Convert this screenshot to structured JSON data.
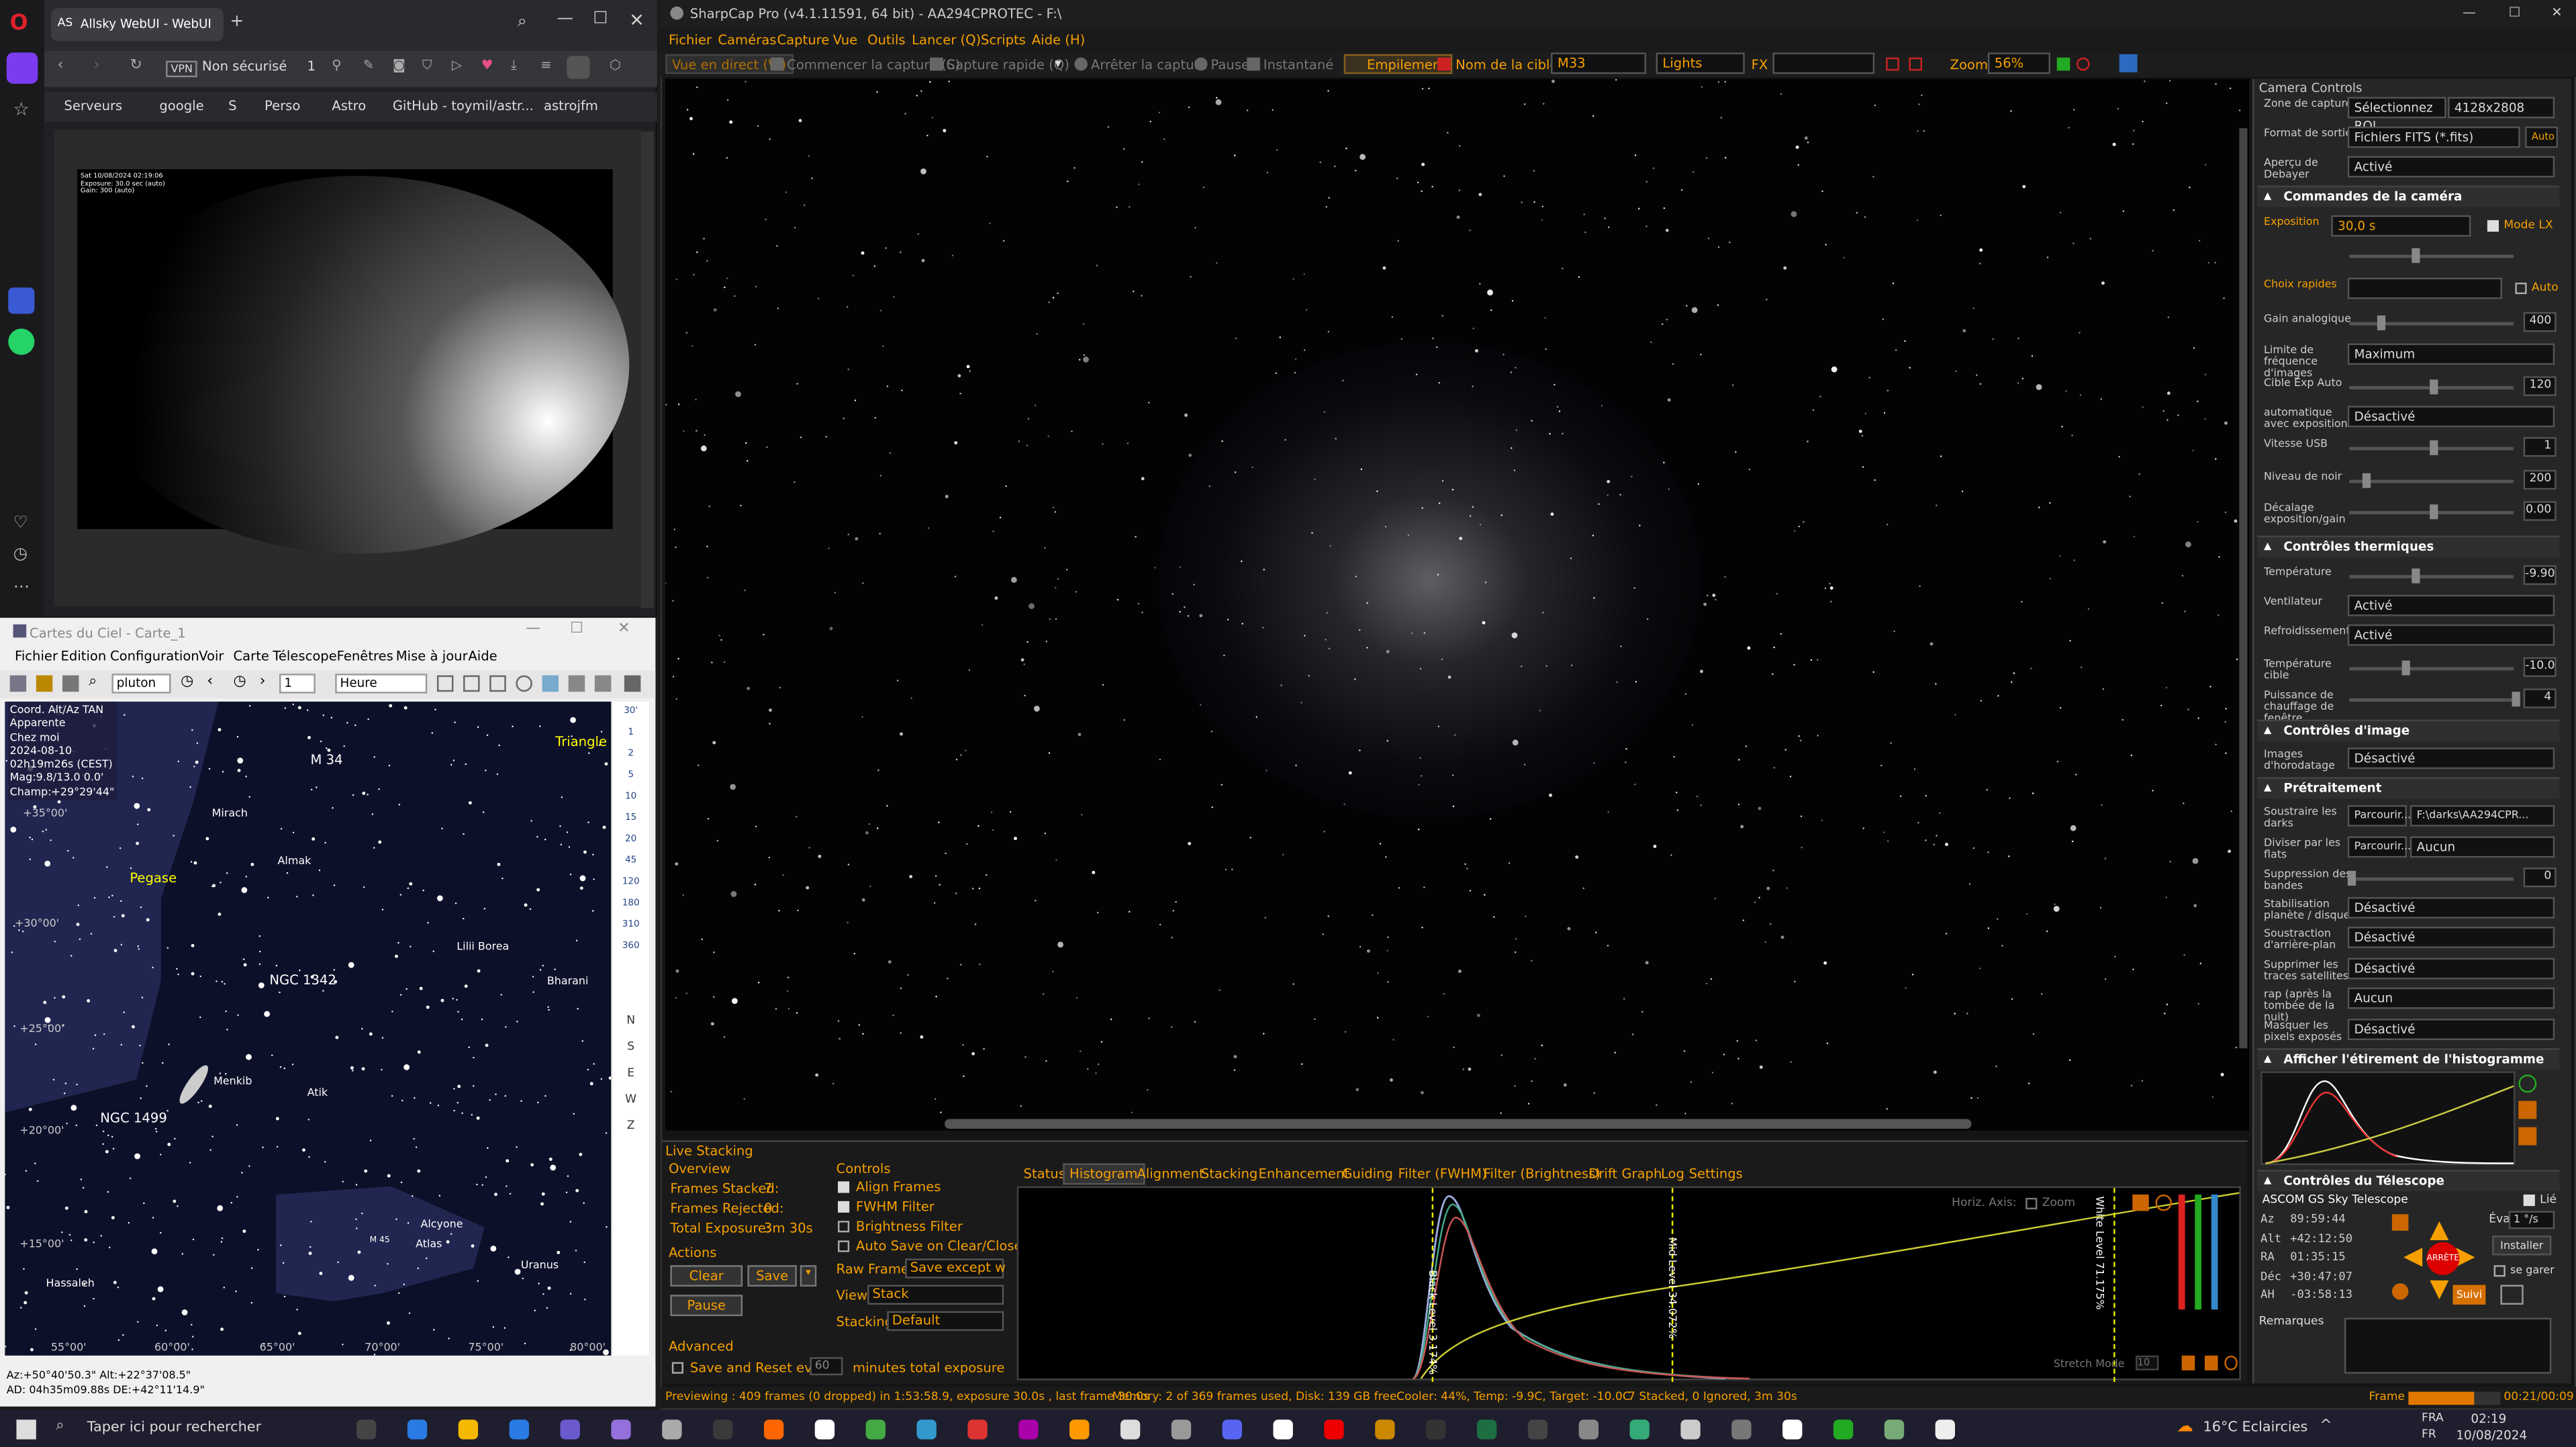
{
  "opera": {
    "tab_title": "Allsky WebUI - WebUI",
    "tab_icon": "AS",
    "security": "Non sécurisé",
    "vpn": "VPN",
    "tab_count": "1",
    "bookmarks": [
      "Serveurs",
      "google",
      "S",
      "Perso",
      "Astro",
      "GitHub - toymil/astr...",
      "astrojfm"
    ],
    "allsky_overlay": [
      "Sat 10/08/2024 02:19:06",
      "Exposure: 30.0 sec (auto)",
      "Gain: 300 (auto)"
    ]
  },
  "cdc": {
    "title": "Cartes du Ciel - Carte_1",
    "menu": [
      "Fichier",
      "Edition",
      "Configuration",
      "Voir",
      "Carte",
      "Télescope",
      "Fenêtres",
      "Mise à jour",
      "Aide"
    ],
    "search_value": "pluton",
    "step_value": "1",
    "time_unit": "Heure",
    "info": [
      "Coord. Alt/Az TAN",
      "Apparente",
      "Chez moi",
      "2024-08-10",
      "02h19m26s (CEST)",
      "Mag:9.8/13.0 0.0'",
      "Champ:+29°29'44\""
    ],
    "labels": {
      "triangle": "Triangle",
      "m34": "M 34",
      "mirach": "Mirach",
      "almak": "Almak",
      "pegase": "Pegase",
      "ngc1342": "NGC 1342",
      "ngc1499": "NGC 1499",
      "lilii": "Lilii Borea",
      "bharani": "Bharani",
      "menkib": "Menkib",
      "atik": "Atik",
      "alcyone": "Alcyone",
      "atlas": "Atlas",
      "uranus": "Uranus",
      "hassaleh": "Hassaleh",
      "m45": "M 45"
    },
    "ticks_y": [
      "+35°00'",
      "+30°00'",
      "+25°00'",
      "+20°00'",
      "+15°00'"
    ],
    "ticks_x": [
      "55°00'",
      "60°00'",
      "65°00'",
      "70°00'",
      "75°00'",
      "80°00'"
    ],
    "right_scale": [
      "30'",
      "1",
      "2",
      "5",
      "10",
      "15",
      "20",
      "45",
      "120",
      "180",
      "310",
      "360"
    ],
    "compass": [
      "N",
      "S",
      "E",
      "W",
      "Z"
    ],
    "status": [
      "Az:+50°40'50.3\" Alt:+22°37'08.5\"",
      "AD: 04h35m09.88s DE:+42°11'14.9\""
    ]
  },
  "sharpcap": {
    "title": "SharpCap Pro (v4.1.11591, 64 bit) - AA294CPROTEC - F:\\",
    "window_controls": [
      "—",
      "☐",
      "✕"
    ],
    "menu": [
      "Fichier",
      "Caméras",
      "Capture",
      "Vue",
      "Outils",
      "Lancer (Q)",
      "Scripts",
      "Aide (H)"
    ],
    "toolbar": {
      "live": "Vue en direct (W)",
      "start": "Commencer la capture (S)",
      "quick": "Capture rapide (Q)",
      "stop": "Arrêter la capture",
      "pause": "Pause",
      "snap": "Instantané",
      "stack": "Empilement",
      "target_label": "Nom de la cible:",
      "target": "M33",
      "frame_type": "Lights",
      "fx": "FX",
      "zoom_label": "Zoom:",
      "zoom": "56%"
    },
    "panel": {
      "title": "Camera Controls",
      "rows1": [
        [
          "Zone de capture",
          "Sélectionnez ROI",
          "4128x2808"
        ],
        [
          "Format de sortie",
          "Fichiers FITS (*.fits)",
          "Auto"
        ],
        [
          "Aperçu de Debayer",
          "Activé",
          ""
        ]
      ],
      "sec_camera": "Commandes de la caméra",
      "exposition_label": "Exposition",
      "exposition": "30,0 s",
      "mode_lx": "Mode LX",
      "quick_label": "Choix rapides",
      "auto_label": "Auto",
      "gain_label": "Gain analogique",
      "gain": "400",
      "fps_label": "Limite de fréquence d'images",
      "fps": "Maximum",
      "target_label": "Cible Exp Auto",
      "target": "120",
      "autoexp_label": "automatique avec exposition",
      "autoexp": "Désactivé",
      "usb_label": "Vitesse USB",
      "usb": "1",
      "black_label": "Niveau de noir",
      "black": "200",
      "offset_label": "Décalage exposition/gain",
      "offset": "0.00",
      "sec_thermal": "Contrôles thermiques",
      "temp_label": "Température",
      "temp": "-9.90",
      "fan_label": "Ventilateur",
      "fan": "Activé",
      "cool_label": "Refroidissement",
      "cool": "Activé",
      "ttarget_label": "Température cible",
      "ttarget": "-10.0",
      "heat_label": "Puissance de chauffage de fenêtre",
      "heat": "4",
      "sec_image": "Contrôles d'image",
      "ts_label": "Images d'horodatage",
      "ts": "Désactivé",
      "sec_pre": "Prétraitement",
      "darks_label": "Soustraire les darks",
      "browse": "Parcourir...",
      "darks": "F:\\darks\\AA294CPR...",
      "flats_label": "Diviser par les flats",
      "flats": "Aucun",
      "band_label": "Suppression des bandes",
      "band": "0",
      "stab_label": "Stabilisation planète / disque",
      "stab": "Désactivé",
      "bg_label": "Soustraction d'arrière-plan",
      "bg": "Désactivé",
      "sat_label": "Supprimer les traces satellites",
      "sat": "Désactivé",
      "rap_label": "rap (après la tombée de la nuit)",
      "rap": "Aucun",
      "hot_label": "Masquer les pixels exposés",
      "hot": "Désactivé",
      "sec_hist": "Afficher l'étirement de l'histogramme",
      "sec_scope": "Contrôles du Télescope",
      "scope_name": "ASCOM GS Sky Telescope",
      "link": "Lié",
      "az_lab": "Az",
      "az": "89:59:44",
      "alt_lab": "Alt",
      "alt": "+42:12:50",
      "ra_lab": "RA",
      "ra": "01:35:15",
      "dec_lab": "Déc",
      "dec": "+30:47:07",
      "ah_lab": "AH",
      "ah": "-03:58:13",
      "slew_label": "Évaluer:",
      "slew": "1 °/s",
      "install": "Installer",
      "park_label": "se garer",
      "track": "Suivi",
      "stop": "ARRÊTE",
      "notes": "Remarques"
    },
    "stacking": {
      "title": "Live Stacking",
      "overview": "Overview",
      "stacked_l": "Frames Stacked:",
      "stacked": "7",
      "rej_l": "Frames Rejected:",
      "rej": "0",
      "tot_l": "Total Exposure:",
      "tot": "3m 30s",
      "actions": "Actions",
      "clear": "Clear",
      "save": "Save",
      "pause": "Pause",
      "advanced": "Advanced",
      "save_reset": "Save and Reset every",
      "save_min": "60",
      "minutes": "minutes total exposure",
      "controls": "Controls",
      "align": "Align Frames",
      "fwhm": "FWHM Filter",
      "bright": "Brightness Filter",
      "autosave": "Auto Save on Clear/Close",
      "raw_l": "Raw Frames",
      "raw": "Save except w",
      "view_l": "View",
      "view": "Stack",
      "stack_l": "Stacking",
      "stack": "Default",
      "tabs": [
        "Status",
        "Histogram",
        "Alignment",
        "Stacking",
        "Enhancement",
        "Guiding",
        "Filter (FWHM)",
        "Filter (Brightness)",
        "Drift Graph",
        "Log",
        "Settings"
      ],
      "horiz": "Horiz. Axis:",
      "zoom": "Zoom",
      "black": "Black Level 3.174%",
      "mid": "Mid Level 34.072%",
      "white": "White Level 71.175%",
      "stretch": "Stretch Mode",
      "stretch_v": "10"
    },
    "status": {
      "preview": "Previewing : 409 frames (0 dropped) in 1:53:58.9, exposure 30.0s , last frame 30.0s",
      "memory": "Memory: 2 of 369 frames used, Disk: 139 GB free",
      "cooler": "Cooler: 44%, Temp: -9.9C, Target: -10.0C",
      "stacked": "7 Stacked, 0 Ignored, 3m 30s",
      "frame": "Frame :",
      "time": "00:21/00:09"
    }
  },
  "taskbar": {
    "search": "Taper ici pour rechercher",
    "weather": "16°C Eclaircies",
    "lang": "FRA",
    "lang2": "FR",
    "clock": "02:19",
    "date": "10/08/2024"
  },
  "colors": {
    "accent": "#ff8c00",
    "sc_bg": "#141414",
    "chart_bg": "#0d1029"
  }
}
